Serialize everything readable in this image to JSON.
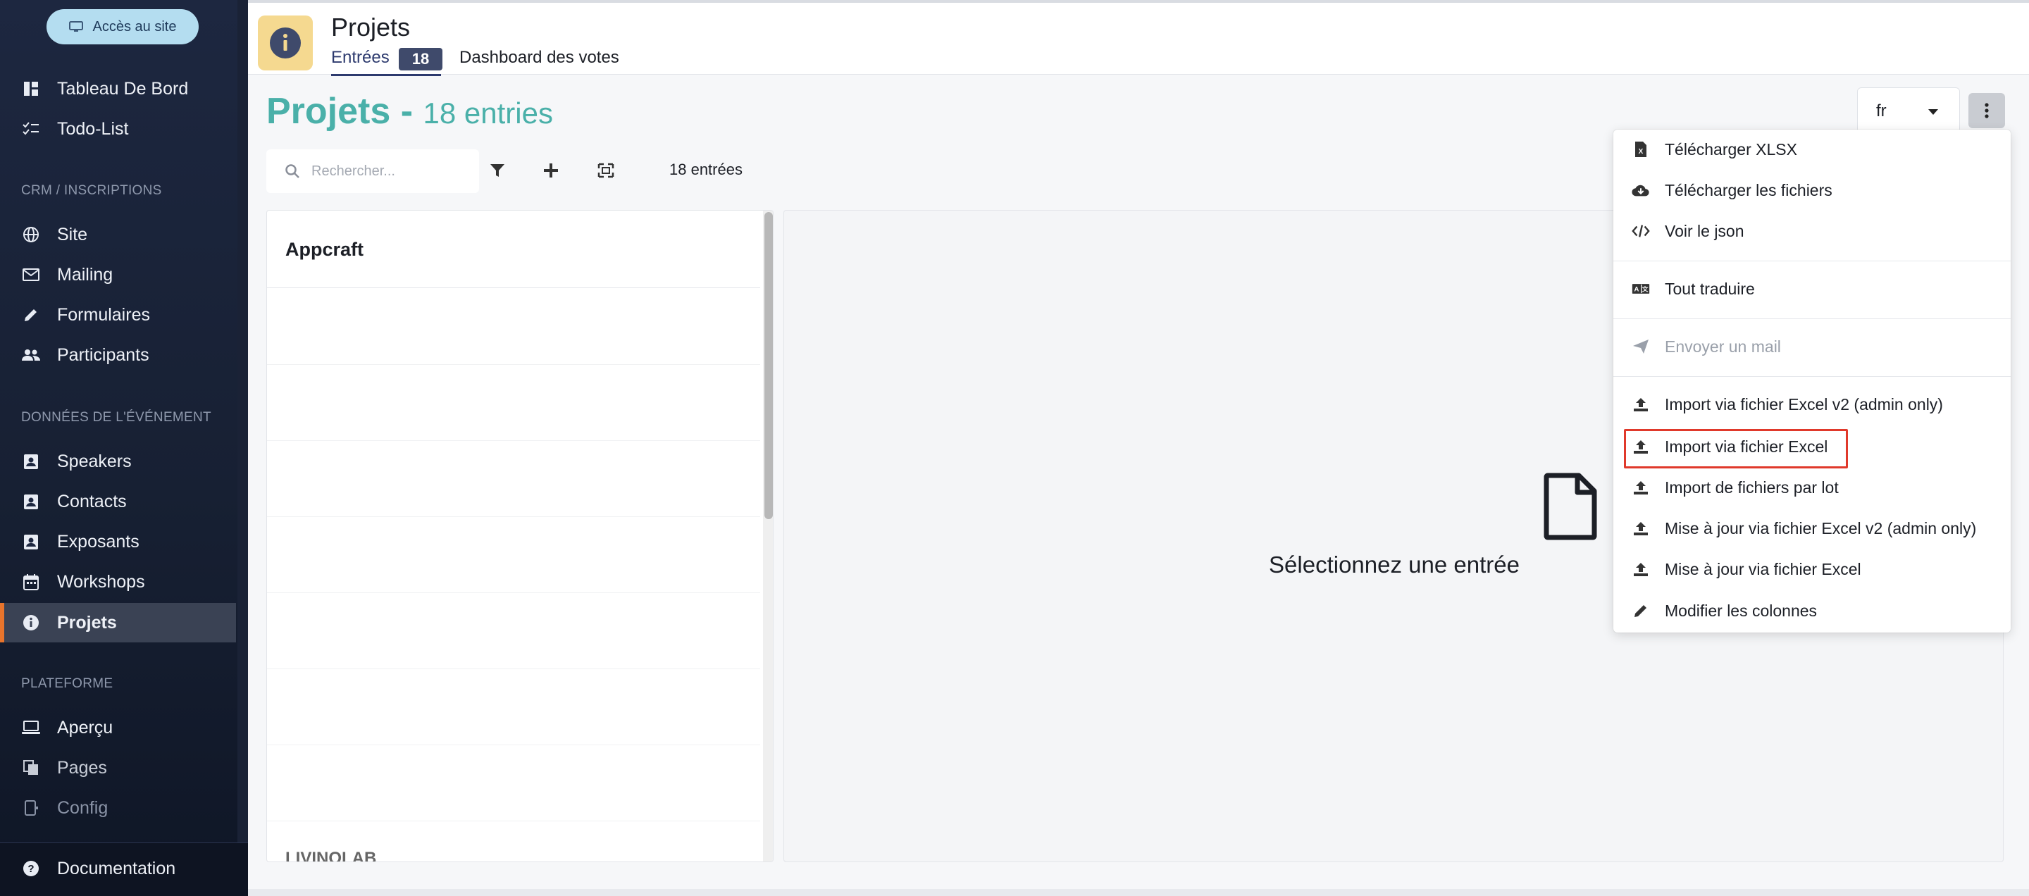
{
  "sidebar": {
    "site_button": "Accès au site",
    "items_top": [
      {
        "label": "Tableau De Bord",
        "icon": "dashboard-icon"
      },
      {
        "label": "Todo-List",
        "icon": "checklist-icon"
      }
    ],
    "section_crm": "CRM / INSCRIPTIONS",
    "items_crm": [
      {
        "label": "Site",
        "icon": "globe-icon"
      },
      {
        "label": "Mailing",
        "icon": "mail-icon"
      },
      {
        "label": "Formulaires",
        "icon": "pencil-icon"
      },
      {
        "label": "Participants",
        "icon": "people-icon"
      }
    ],
    "section_event": "DONNÉES DE L'ÉVÉNEMENT",
    "items_event": [
      {
        "label": "Speakers",
        "icon": "contact-card-icon"
      },
      {
        "label": "Contacts",
        "icon": "contact-card-icon"
      },
      {
        "label": "Exposants",
        "icon": "contact-card-icon"
      },
      {
        "label": "Workshops",
        "icon": "calendar-icon"
      },
      {
        "label": "Projets",
        "icon": "info-icon",
        "active": true
      }
    ],
    "section_platform": "PLATEFORME",
    "items_platform": [
      {
        "label": "Aperçu",
        "icon": "laptop-icon"
      },
      {
        "label": "Pages",
        "icon": "pages-icon"
      },
      {
        "label": "Config",
        "icon": "config-icon"
      }
    ],
    "footer": {
      "label": "Documentation",
      "icon": "help-icon"
    }
  },
  "header": {
    "title": "Projets",
    "tabs": [
      {
        "label": "Entrées",
        "badge": "18",
        "active": true
      },
      {
        "label": "Dashboard des votes"
      }
    ]
  },
  "page": {
    "heading": "Projets -",
    "heading_count": "18 entries",
    "search_placeholder": "Rechercher...",
    "entries_label": "18 entrées",
    "language": "fr"
  },
  "list": {
    "first_item": "Appcraft",
    "cut_item": "LIVINOLAB"
  },
  "detail": {
    "empty_message": "Sélectionnez une entrée"
  },
  "menu": {
    "items": [
      {
        "label": "Télécharger XLSX",
        "icon": "file-excel-icon"
      },
      {
        "label": "Télécharger les fichiers",
        "icon": "cloud-download-icon"
      },
      {
        "label": "Voir le json",
        "icon": "code-icon"
      },
      {
        "label": "Tout traduire",
        "icon": "translate-icon"
      },
      {
        "label": "Envoyer un mail",
        "icon": "send-icon",
        "disabled": true
      },
      {
        "label": "Import via fichier Excel v2 (admin only)",
        "icon": "upload-icon"
      },
      {
        "label": "Import via fichier Excel",
        "icon": "upload-icon",
        "highlighted": true
      },
      {
        "label": "Import de fichiers par lot",
        "icon": "upload-icon"
      },
      {
        "label": "Mise à jour via fichier Excel v2 (admin only)",
        "icon": "upload-icon"
      },
      {
        "label": "Mise à jour via fichier Excel",
        "icon": "upload-icon"
      },
      {
        "label": "Modifier les colonnes",
        "icon": "pencil-icon"
      }
    ]
  },
  "colors": {
    "accent_teal": "#4ab0a9",
    "active_marker": "#e8742c",
    "highlight_red": "#e0392b",
    "sidebar_bg": "#1d2740"
  }
}
